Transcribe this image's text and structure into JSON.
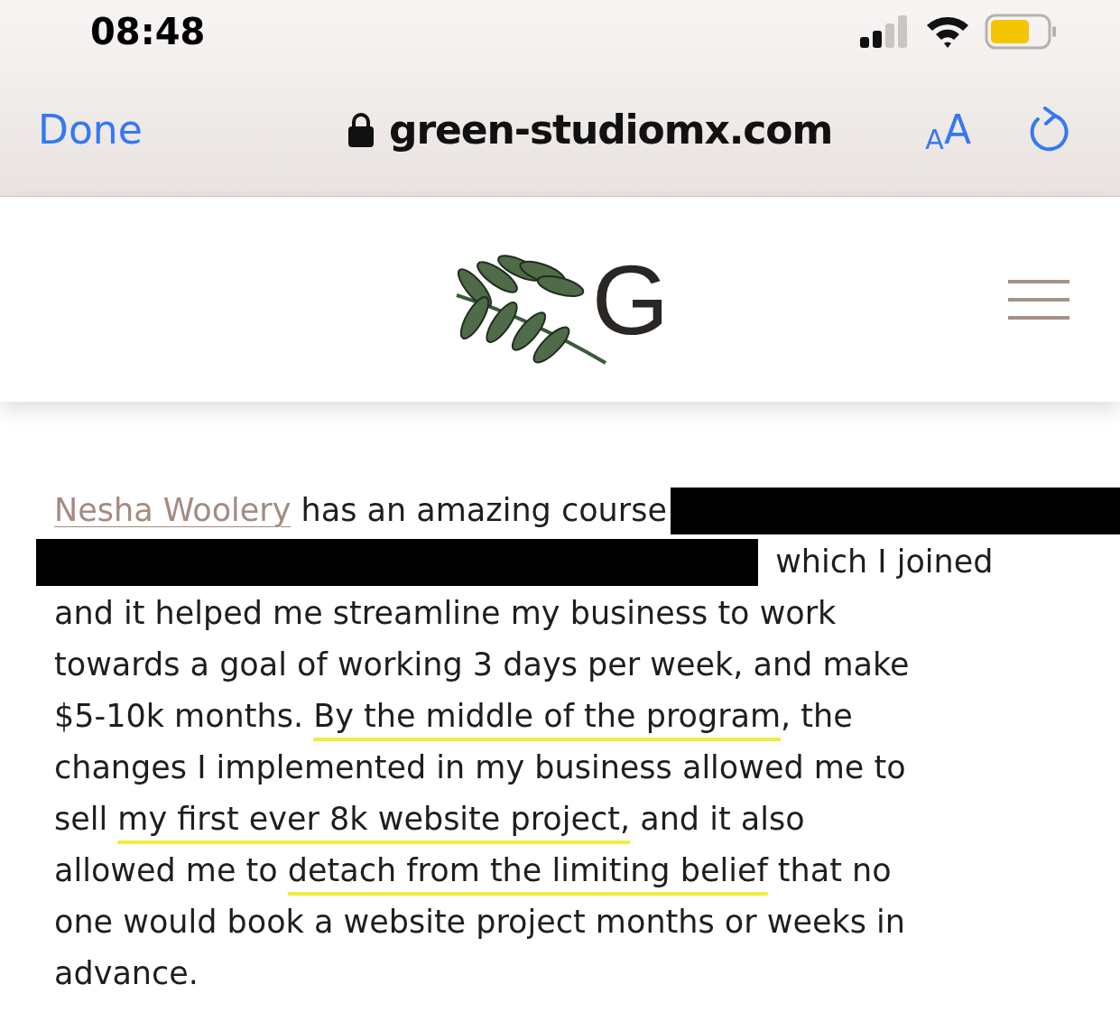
{
  "status_bar": {
    "time": "08:48"
  },
  "browser_bar": {
    "done": "Done",
    "url": "green-studiomx.com",
    "text_size_small": "A",
    "text_size_large": "A"
  },
  "site_header": {
    "logo_letter": "G"
  },
  "paragraph": {
    "lines": [
      [
        {
          "kind": "link",
          "text": "Nesha Woolery"
        },
        {
          "kind": "text",
          "text": " has an amazing course"
        },
        {
          "kind": "redaction"
        }
      ],
      [
        {
          "kind": "redaction"
        },
        {
          "kind": "text",
          "text": " which I joined"
        }
      ],
      [
        {
          "kind": "text",
          "text": "and it helped me streamline my business to work"
        }
      ],
      [
        {
          "kind": "text",
          "text": "towards a goal of working 3 days per week, and make"
        }
      ],
      [
        {
          "kind": "text",
          "text": "$5-10k months. "
        },
        {
          "kind": "marked",
          "text": "By the middle of the program"
        },
        {
          "kind": "text",
          "text": ", the"
        }
      ],
      [
        {
          "kind": "text",
          "text": "changes I implemented in my business allowed me to"
        }
      ],
      [
        {
          "kind": "text",
          "text": "sell "
        },
        {
          "kind": "marked",
          "text": "my first ever 8k website project,"
        },
        {
          "kind": "text",
          "text": " and it also"
        }
      ],
      [
        {
          "kind": "text",
          "text": "allowed me to "
        },
        {
          "kind": "marked",
          "text": "detach from the limiting belief"
        },
        {
          "kind": "text",
          "text": " that no"
        }
      ],
      [
        {
          "kind": "text",
          "text": "one would book a website project months or weeks in"
        }
      ],
      [
        {
          "kind": "text",
          "text": "advance."
        }
      ]
    ]
  }
}
